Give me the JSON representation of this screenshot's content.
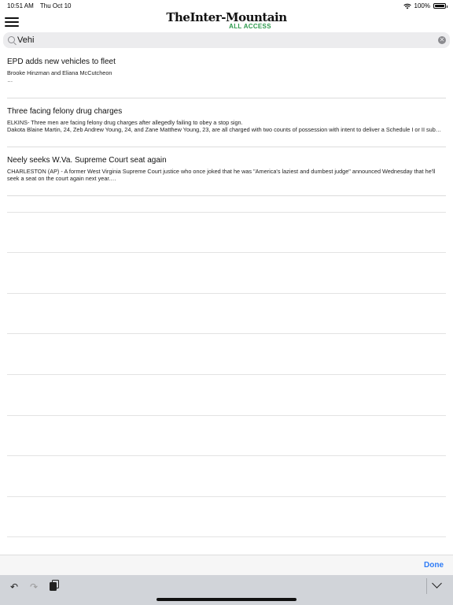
{
  "status_bar": {
    "time": "10:51 AM",
    "date": "Thu Oct 10",
    "battery": "100%",
    "battery_level": 1.0
  },
  "header": {
    "logo_main": "TheInter-Mountain",
    "logo_sub": "ALL ACCESS",
    "menu_icon": "hamburger-menu-icon"
  },
  "search": {
    "query": "Vehi",
    "icon": "search-icon",
    "clear_icon": "clear-icon"
  },
  "results": [
    {
      "title": "EPD adds new vehicles to fleet",
      "lines": [
        "Brooke Hinzman and Eliana McCutcheon",
        "…"
      ]
    },
    {
      "title": "Three facing felony drug charges",
      "lines": [
        "ELKINS- Three men are facing felony drug charges after allegedly failing to obey a stop sign.",
        "Dakota Blaine Martin, 24, Zeb Andrew Young, 24, and Zane Matthew Young, 23, are all charged with two counts of possession with intent to deliver a Schedule I or II sub…"
      ]
    },
    {
      "title": "Neely seeks W.Va. Supreme Court seat again",
      "lines": [
        "CHARLESTON (AP) - A former West Virginia Supreme Court justice who once joked that he was \"America's laziest and dumbest judge\" announced Wednesday that he'll seek a seat on the court again next year.…"
      ]
    }
  ],
  "accessory": {
    "done_label": "Done"
  },
  "keyboard": {
    "undo_glyph": "↶",
    "redo_glyph": "↷"
  }
}
